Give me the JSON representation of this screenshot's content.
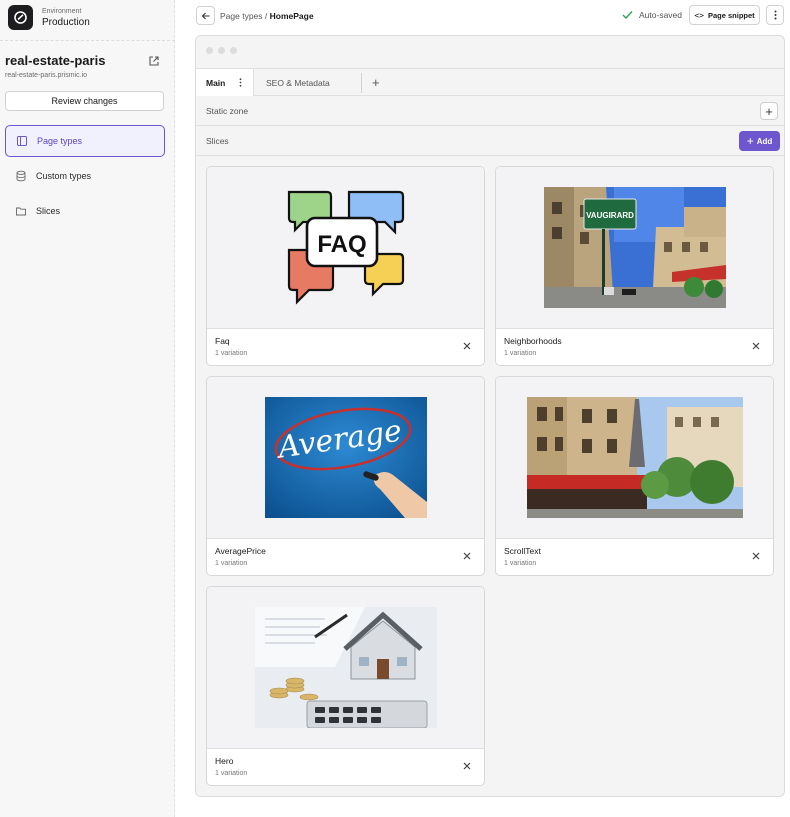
{
  "sidebar": {
    "environment_label": "Environment",
    "environment_value": "Production",
    "repo_name": "real-estate-paris",
    "repo_url": "real-estate-paris.prismic.io",
    "review_button": "Review changes",
    "nav": [
      {
        "label": "Page types",
        "icon": "page-types-icon",
        "active": true
      },
      {
        "label": "Custom types",
        "icon": "database-icon",
        "active": false
      },
      {
        "label": "Slices",
        "icon": "folder-icon",
        "active": false
      }
    ]
  },
  "topbar": {
    "breadcrumb_parent": "Page types / ",
    "breadcrumb_current": "HomePage",
    "status": "Auto-saved",
    "snippet_button": "Page snippet"
  },
  "editor": {
    "tabs": [
      {
        "label": "Main",
        "active": true
      },
      {
        "label": "SEO & Metadata",
        "active": false
      }
    ],
    "static_zone_label": "Static zone",
    "slices_label": "Slices",
    "add_button": "Add",
    "slices": [
      {
        "name": "Faq",
        "variations": "1 variation",
        "image": "faq-speech-bubbles-illustration"
      },
      {
        "name": "Neighborhoods",
        "variations": "1 variation",
        "image": "paris-street-photo"
      },
      {
        "name": "AveragePrice",
        "variations": "1 variation",
        "image": "average-word-on-blue-board"
      },
      {
        "name": "ScrollText",
        "variations": "1 variation",
        "image": "paris-building-with-eiffel-tower"
      },
      {
        "name": "Hero",
        "variations": "1 variation",
        "image": "house-model-coins-calculator"
      }
    ]
  },
  "colors": {
    "accent": "#6e56cf",
    "success": "#2e9e5b",
    "panel_bg": "#f4f4f5"
  }
}
